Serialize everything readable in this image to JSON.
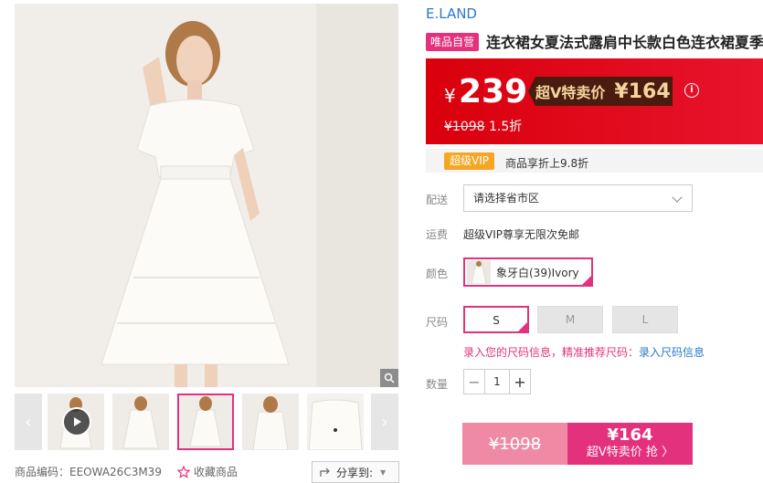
{
  "gallery": {
    "product_code_label": "商品编码：",
    "product_code": "EEOWA26C3M39",
    "favorite_label": "收藏商品",
    "share_label": "分享到:"
  },
  "product": {
    "brand": "E.LAND",
    "self_badge": "唯品自营",
    "title": "连衣裙女夏法式露肩中长款白色连衣裙夏季"
  },
  "price": {
    "currency": "¥",
    "sale_price": "239",
    "vip_label": "超V特卖价",
    "vip_price": "¥164",
    "original_price": "¥1098",
    "discount": "1.5折"
  },
  "vip": {
    "badge": "超级VIP",
    "text": "商品享折上9.8折"
  },
  "delivery": {
    "label": "配送",
    "placeholder": "请选择省市区"
  },
  "shipping": {
    "label": "运费",
    "text": "超级VIP尊享无限次免邮"
  },
  "color": {
    "label": "颜色",
    "selected": "象牙白(39)Ivory"
  },
  "size": {
    "label": "尺码",
    "options": [
      "S",
      "M",
      "L"
    ],
    "tip_prefix": "录入您的尺码信息，精准推荐尺码：",
    "tip_link": "录入尺码信息"
  },
  "quantity": {
    "label": "数量",
    "value": "1",
    "minus": "−",
    "plus": "+"
  },
  "buy": {
    "original": "¥1098",
    "vip_price": "¥164",
    "action": "超V特卖价 抢 〉"
  }
}
